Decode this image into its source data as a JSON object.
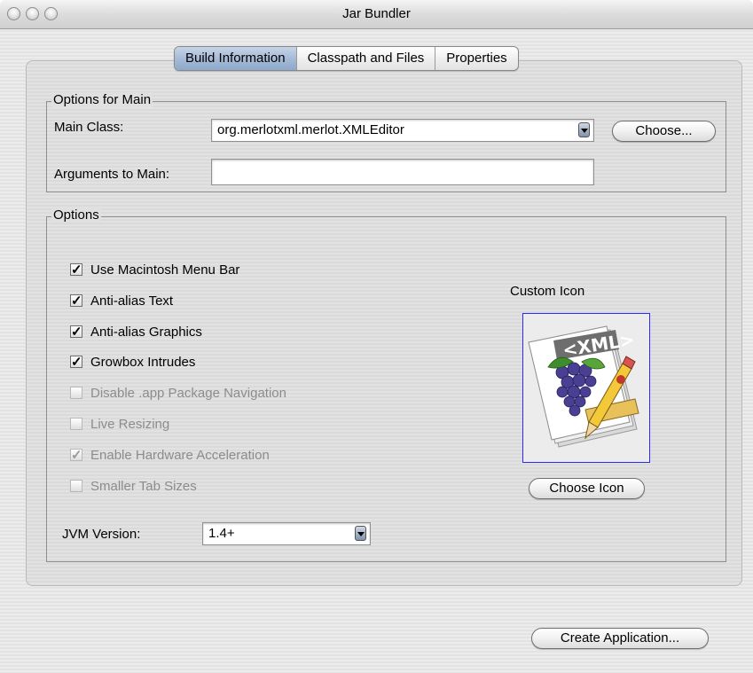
{
  "window": {
    "title": "Jar Bundler"
  },
  "tabs": [
    {
      "label": "Build Information",
      "active": true
    },
    {
      "label": "Classpath and Files",
      "active": false
    },
    {
      "label": "Properties",
      "active": false
    }
  ],
  "main_options": {
    "legend": "Options for Main",
    "main_class_label": "Main Class:",
    "main_class_value": "org.merlotxml.merlot.XMLEditor",
    "choose_label": "Choose...",
    "arguments_label": "Arguments to Main:",
    "arguments_value": ""
  },
  "options": {
    "legend": "Options",
    "checkboxes": [
      {
        "label": "Use Macintosh Menu Bar",
        "checked": true,
        "enabled": true
      },
      {
        "label": "Anti-alias Text",
        "checked": true,
        "enabled": true
      },
      {
        "label": "Anti-alias Graphics",
        "checked": true,
        "enabled": true
      },
      {
        "label": "Growbox Intrudes",
        "checked": true,
        "enabled": true
      },
      {
        "label": "Disable .app Package Navigation",
        "checked": false,
        "enabled": false
      },
      {
        "label": "Live Resizing",
        "checked": false,
        "enabled": false
      },
      {
        "label": "Enable Hardware Acceleration",
        "checked": true,
        "enabled": false
      },
      {
        "label": "Smaller Tab Sizes",
        "checked": false,
        "enabled": false
      }
    ],
    "jvm_label": "JVM Version:",
    "jvm_value": "1.4+",
    "custom_icon_label": "Custom Icon",
    "icon_text": "<XML>",
    "choose_icon_label": "Choose Icon"
  },
  "footer": {
    "create_label": "Create Application..."
  },
  "colors": {
    "tab_active": "#a6bbd7",
    "icon_well_border": "#2a2aff"
  }
}
